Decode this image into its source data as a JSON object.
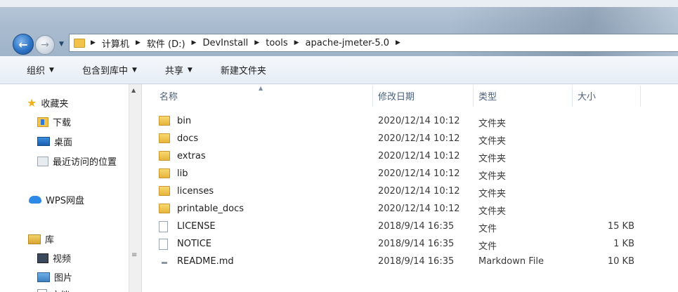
{
  "address_bar": {
    "crumbs": [
      "计算机",
      "软件 (D:)",
      "DevInstall",
      "tools",
      "apache-jmeter-5.0"
    ]
  },
  "toolbar": {
    "organize": "组织",
    "include_in_library": "包含到库中",
    "share": "共享",
    "new_folder": "新建文件夹"
  },
  "sidebar": {
    "favorites": "收藏夹",
    "downloads": "下载",
    "desktop": "桌面",
    "recent": "最近访问的位置",
    "wps": "WPS网盘",
    "libraries": "库",
    "videos": "视频",
    "pictures": "图片",
    "documents": "文档"
  },
  "columns": {
    "name": "名称",
    "date": "修改日期",
    "type": "类型",
    "size": "大小"
  },
  "files": [
    {
      "name": "bin",
      "date": "2020/12/14 10:12",
      "type": "文件夹",
      "size": "",
      "icon": "folder"
    },
    {
      "name": "docs",
      "date": "2020/12/14 10:12",
      "type": "文件夹",
      "size": "",
      "icon": "folder"
    },
    {
      "name": "extras",
      "date": "2020/12/14 10:12",
      "type": "文件夹",
      "size": "",
      "icon": "folder"
    },
    {
      "name": "lib",
      "date": "2020/12/14 10:12",
      "type": "文件夹",
      "size": "",
      "icon": "folder"
    },
    {
      "name": "licenses",
      "date": "2020/12/14 10:12",
      "type": "文件夹",
      "size": "",
      "icon": "folder"
    },
    {
      "name": "printable_docs",
      "date": "2020/12/14 10:12",
      "type": "文件夹",
      "size": "",
      "icon": "folder"
    },
    {
      "name": "LICENSE",
      "date": "2018/9/14 16:35",
      "type": "文件",
      "size": "15 KB",
      "icon": "file"
    },
    {
      "name": "NOTICE",
      "date": "2018/9/14 16:35",
      "type": "文件",
      "size": "1 KB",
      "icon": "file"
    },
    {
      "name": "README.md",
      "date": "2018/9/14 16:35",
      "type": "Markdown File",
      "size": "10 KB",
      "icon": "markdown"
    }
  ]
}
